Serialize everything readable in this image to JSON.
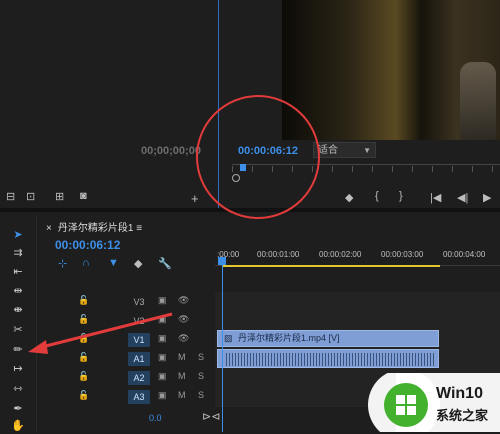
{
  "source_monitor": {
    "timecode": "00;00;00;00"
  },
  "program_monitor": {
    "timecode": "00:00:06:12",
    "fit_select": "适合"
  },
  "timeline": {
    "tab_label": "丹泽尔精彩片段1",
    "tab_close": "×",
    "timecode": "00:00:06:12",
    "ruler_labels": [
      ":00:00",
      "00:00:01:00",
      "00:00:02:00",
      "00:00:03:00",
      "00:00:04:00"
    ],
    "tracks": [
      {
        "id": "V3",
        "selected": false
      },
      {
        "id": "V2",
        "selected": false
      },
      {
        "id": "V1",
        "selected": true
      },
      {
        "id": "A1",
        "selected": true
      },
      {
        "id": "A2",
        "selected": true
      },
      {
        "id": "A3",
        "selected": true
      }
    ],
    "video_clip": "丹泽尔精彩片段1.mp4 [V]",
    "master_value": "0.0"
  },
  "audio_buttons": {
    "mute": "M",
    "solo": "S"
  },
  "watermark": {
    "brand": "Win10",
    "subtitle": "系统之家"
  },
  "colors": {
    "accent": "#3d8fe8",
    "annotation": "#e23b3b",
    "clip": "#7f9ed6",
    "playrange": "#e2c82e"
  }
}
